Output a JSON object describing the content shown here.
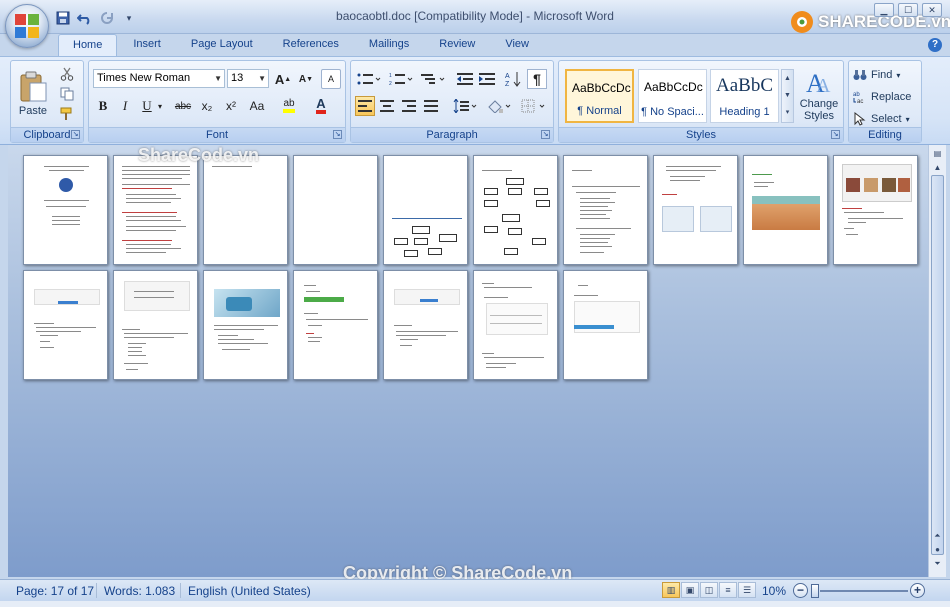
{
  "window": {
    "title": "baocaobtl.doc [Compatibility Mode] - Microsoft Word",
    "controls": {
      "minimize": "▁",
      "maximize": "☐",
      "close": "✕"
    }
  },
  "brand": {
    "logo_text": "SHARECODE.vn",
    "logo_prefix": "S",
    "logo_rest": "HARECODE.vn"
  },
  "watermarks": {
    "top": "ShareCode.vn",
    "bottom": "Copyright © ShareCode.vn"
  },
  "tabs": [
    {
      "label": "Home",
      "active": true
    },
    {
      "label": "Insert"
    },
    {
      "label": "Page Layout"
    },
    {
      "label": "References"
    },
    {
      "label": "Mailings"
    },
    {
      "label": "Review"
    },
    {
      "label": "View"
    }
  ],
  "help_label": "?",
  "ribbon": {
    "clipboard": {
      "label": "Clipboard",
      "paste": "Paste"
    },
    "font": {
      "label": "Font",
      "font_name": "Times New Roman",
      "font_size": "13",
      "bold": "B",
      "italic": "I",
      "underline": "U",
      "strike": "abc",
      "subscript": "x₂",
      "superscript": "x²",
      "change_case": "Aa",
      "grow": "A",
      "shrink": "A",
      "clear": "A",
      "highlight": "ab",
      "font_color": "A"
    },
    "paragraph": {
      "label": "Paragraph",
      "pilcrow": "¶"
    },
    "styles": {
      "label": "Styles",
      "items": [
        {
          "sample": "AaBbCcDc",
          "name": "¶ Normal"
        },
        {
          "sample": "AaBbCcDc",
          "name": "¶ No Spaci..."
        },
        {
          "sample": "AaBbC",
          "name": "Heading 1"
        }
      ],
      "change_styles": "Change Styles"
    },
    "editing": {
      "label": "Editing",
      "find": "Find",
      "replace": "Replace",
      "select": "Select"
    }
  },
  "status": {
    "page": "Page: 17 of 17",
    "words": "Words: 1.083",
    "language": "English (United States)",
    "zoom": "10%"
  },
  "colors": {
    "accent": "#15428b",
    "highlight_yellow": "#ffff00",
    "font_red": "#e0241b",
    "style_selected": "#f0b542"
  }
}
